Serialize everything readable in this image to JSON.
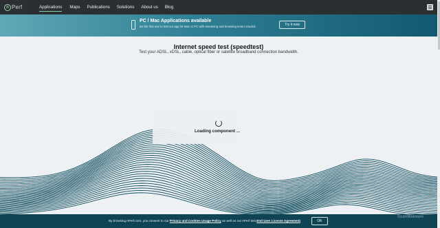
{
  "logo": {
    "mark": "n",
    "text": "Perf"
  },
  "nav": {
    "items": [
      {
        "label": "Applications",
        "active": true
      },
      {
        "label": "Maps"
      },
      {
        "label": "Publications"
      },
      {
        "label": "Solutions"
      },
      {
        "label": "About us"
      },
      {
        "label": "Blog"
      }
    ],
    "menu_icon": "hamburger-icon"
  },
  "banner": {
    "icon": "monitor-icon",
    "title": "PC / Mac Applications available",
    "subtitle": "Be the first one to test our app for Mac or PC with streaming and browsing tests included.",
    "button": "Try it now"
  },
  "main": {
    "title": "Internet speed test (speedtest)",
    "subtitle": "Test your ADSL, xDSL, cable, optical fiber or satellite broadband connection bandwidth.",
    "loading": "Loading component ..."
  },
  "cookie": {
    "prefix": "By browsing nPerf.com, you consent to our ",
    "link1": "Privacy and Cookies Usage Policy",
    "middle": " as well as our nPerf test ",
    "link2": "End User License Agreement",
    "suffix": ".",
    "button": "OK"
  },
  "watermark": "ScanMalware",
  "colors": {
    "nav_bg": "#2b2f31",
    "accent": "#8ad1a8",
    "wave": "#0d4a5c",
    "cookie_bg": "#0f4455"
  }
}
